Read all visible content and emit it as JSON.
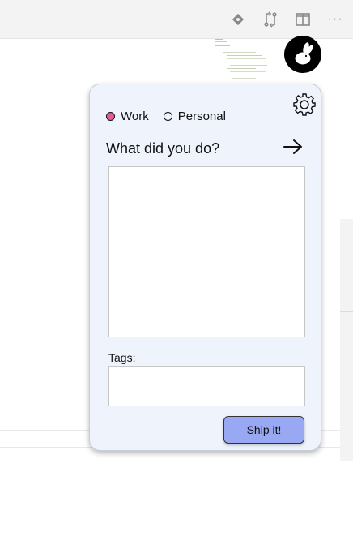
{
  "editor": {
    "toolbar_icons": [
      "diamond-icon",
      "compare-changes-icon",
      "split-editor-icon",
      "more-icon"
    ],
    "more_label": "···"
  },
  "popup": {
    "avatar_icon": "rabbit-icon",
    "settings_icon": "gear-icon",
    "radio_options": [
      {
        "label": "Work",
        "selected": true
      },
      {
        "label": "Personal",
        "selected": false
      }
    ],
    "prompt": "What did you do?",
    "submit_arrow_icon": "arrow-right-icon",
    "entry_value": "",
    "tags_label": "Tags:",
    "tags_value": "",
    "ship_button": "Ship it!",
    "colors": {
      "panel_bg": "#eef3fc",
      "selected_radio": "#e25c9a",
      "ship_button_bg": "#99a8f3"
    }
  }
}
